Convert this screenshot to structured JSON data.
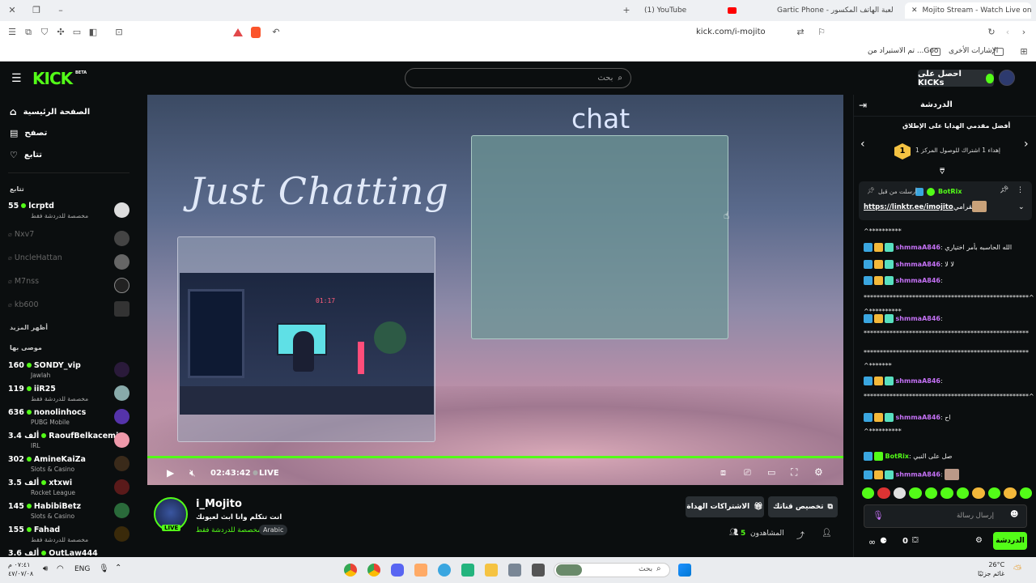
{
  "browser": {
    "tabs": [
      {
        "label": "(1) YouTube"
      },
      {
        "label": "Gartic Phone - لعبة الهاتف المكسور"
      },
      {
        "label": "Mojito Stream - Watch Live on"
      }
    ],
    "url": "kick.com/i-mojito",
    "bookmarks": {
      "folder1": "الإشارات الأخرى",
      "folder2": "تم الاستيراد من ...Goo"
    }
  },
  "header": {
    "logo": "KICK",
    "logo_badge": "BETA",
    "search_placeholder": "بحث",
    "get_kicks": "احصل على KICKs"
  },
  "sidebar": {
    "nav": [
      {
        "label": "الصفحة الرئيسية",
        "icon": "home-icon"
      },
      {
        "label": "تصفح",
        "icon": "browse-icon"
      },
      {
        "label": "تتابع",
        "icon": "heart-icon"
      }
    ],
    "following_header": "تتابع",
    "following": [
      {
        "name": "lcrptd",
        "count": "55",
        "sub": "مخصصة للدردشة فقط",
        "live": true
      },
      {
        "name": "Nxv7",
        "count": "",
        "sub": "",
        "live": false
      },
      {
        "name": "UncleHattan",
        "count": "",
        "sub": "",
        "live": false
      },
      {
        "name": "M7nss",
        "count": "",
        "sub": "",
        "live": false
      },
      {
        "name": "kb600",
        "count": "",
        "sub": "",
        "live": false
      }
    ],
    "show_more": "أظهر المزيد",
    "recommended_header": "موصى بها",
    "recommended": [
      {
        "name": "SONDY_vip",
        "count": "160",
        "sub": "Jawlah"
      },
      {
        "name": "iiR25",
        "count": "119",
        "sub": "مخصصة للدردشة فقط"
      },
      {
        "name": "nonolinhocs",
        "count": "636",
        "sub": "PUBG Mobile"
      },
      {
        "name": "RaoufBelkacemi",
        "count": "3.4 ألف",
        "sub": "IRL"
      },
      {
        "name": "AmineKaiZa",
        "count": "302",
        "sub": "Slots & Casino"
      },
      {
        "name": "xtxwi",
        "count": "3.5 ألف",
        "sub": "Rocket League"
      },
      {
        "name": "HabibiBetz",
        "count": "145",
        "sub": "Slots & Casino"
      },
      {
        "name": "Fahad",
        "count": "155",
        "sub": "مخصصة للدردشة فقط"
      },
      {
        "name": "OutLaw444",
        "count": "3.6 ألف",
        "sub": ""
      }
    ]
  },
  "player": {
    "title_text": "Just Chatting",
    "chat_text": "chat",
    "clock_text": "01:17",
    "time": "02:43:42",
    "live": "LIVE"
  },
  "stream": {
    "name": "i_Mojito",
    "title": "انت تتكلم وانا ابث لعيونك",
    "category": "مخصصة للدردشة فقط",
    "tag": "Arabic",
    "live_badge": "LIVE",
    "customize": "تخصيص قناتك",
    "gift_subs": "الاشتراكات الهداة",
    "viewers_label": "المشاهدون",
    "viewers": "5"
  },
  "chat": {
    "title": "الدردشة",
    "promo_title": "أفضل مقدمي الهدايا على الإطلاق",
    "promo_text": "إهداء 1 اشتراك للوصول المركز 1",
    "promo_rank": "1",
    "pinned_by": "أرسلت من قبل",
    "pinned_user": "BotRix",
    "pinned_text": "انستقرامي",
    "pinned_link": "https://linktr.ee/imojito",
    "messages": [
      {
        "user": "",
        "text": "^**********"
      },
      {
        "user": "shmmaA846",
        "text": "الله الحاسبه بأمر اختياري"
      },
      {
        "user": "shmmaA846",
        "text": "لا لا"
      },
      {
        "user": "shmmaA846",
        "text": ""
      },
      {
        "user": "",
        "text": "***************************************************^"
      },
      {
        "user": "",
        "text": "^**********"
      },
      {
        "user": "shmmaA846",
        "text": ""
      },
      {
        "user": "",
        "text": "***************************************************"
      },
      {
        "user": "",
        "text": "***************************************************"
      },
      {
        "user": "",
        "text": "^*******"
      },
      {
        "user": "shmmaA846",
        "text": ""
      },
      {
        "user": "",
        "text": "***************************************************^"
      },
      {
        "user": "shmmaA846",
        "text": "اح"
      },
      {
        "user": "",
        "text": "^**********"
      },
      {
        "user": "BotRix",
        "text": "صل على النبي"
      },
      {
        "user": "shmmaA846",
        "text": ""
      }
    ],
    "input_placeholder": "إرسال رسالة",
    "send_button": "الدردشة",
    "points": "0"
  },
  "taskbar": {
    "time": "٠٧:٤١ م",
    "date": "٤٧/٠٧/٠٨",
    "lang": "ENG",
    "search": "بحث",
    "weather_temp": "26°C",
    "weather_desc": "غائم جزئيًا"
  },
  "colors": {
    "kick_green": "#53fc18",
    "bg": "#0b0e0f",
    "username": "#c471f5"
  }
}
